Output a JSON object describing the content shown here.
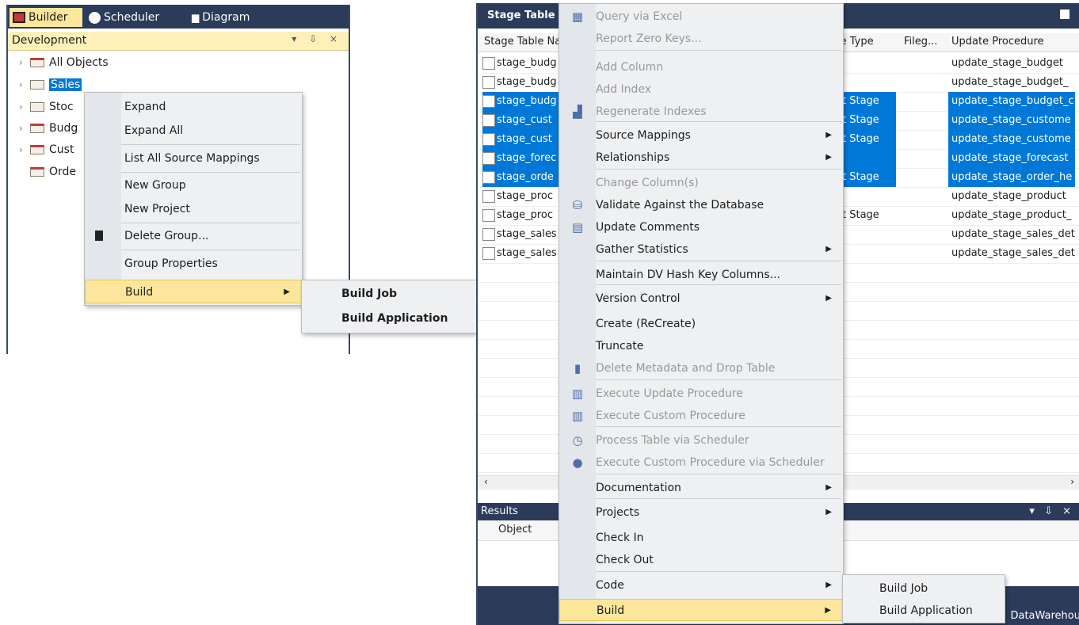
{
  "left_panel": {
    "tabs": [
      {
        "label": "Builder"
      },
      {
        "label": "Scheduler"
      },
      {
        "label": "Diagram"
      }
    ],
    "pane_title": "Development",
    "pane_buttons": "▾ ⇩ ×",
    "tree": [
      {
        "label": "All Objects"
      },
      {
        "label": "Sales"
      },
      {
        "label": "Stoc"
      },
      {
        "label": "Budg"
      },
      {
        "label": "Cust"
      },
      {
        "label": "Orde"
      }
    ],
    "context_menu": [
      {
        "label": "Expand"
      },
      {
        "label": "Expand All"
      },
      {
        "label": "List All Source Mappings"
      },
      {
        "label": "New Group"
      },
      {
        "label": "New Project"
      },
      {
        "label": "Delete Group..."
      },
      {
        "label": "Group Properties"
      },
      {
        "label": "Build"
      }
    ],
    "build_submenu": [
      {
        "label": "Build Job"
      },
      {
        "label": "Build Application"
      }
    ]
  },
  "right_panel": {
    "title": "Stage Table",
    "columns": {
      "name": "Stage Table Na",
      "type": "le Type",
      "file": "Fileg...",
      "proc": "Update Procedure"
    },
    "rows": [
      {
        "name": "stage_budg",
        "type": "",
        "proc": "update_stage_budget",
        "selected": false
      },
      {
        "name": "stage_budg",
        "type": "",
        "proc": "update_stage_budget_",
        "selected": false
      },
      {
        "name": "stage_budg",
        "type": "t Stage",
        "proc": "update_stage_budget_c",
        "selected": true
      },
      {
        "name": "stage_cust",
        "type": "t Stage",
        "proc": "update_stage_custome",
        "selected": true
      },
      {
        "name": "stage_cust",
        "type": "t Stage",
        "proc": "update_stage_custome",
        "selected": true
      },
      {
        "name": "stage_forec",
        "type": "",
        "proc": "update_stage_forecast",
        "selected": true
      },
      {
        "name": "stage_orde",
        "type": "t Stage",
        "proc": "update_stage_order_he",
        "selected": true
      },
      {
        "name": "stage_proc",
        "type": "",
        "proc": "update_stage_product",
        "selected": false
      },
      {
        "name": "stage_proc",
        "type": "t Stage",
        "proc": "update_stage_product_",
        "selected": false
      },
      {
        "name": "stage_sales",
        "type": "",
        "proc": "update_stage_sales_det",
        "selected": false
      },
      {
        "name": "stage_sales",
        "type": "",
        "proc": "update_stage_sales_det",
        "selected": false
      }
    ],
    "results_title": "Results",
    "results_buttons": "▾ ⇩ ×",
    "results_column": "Object",
    "footer_text": "DataWarehou",
    "context_menu": [
      {
        "label": "Query via Excel",
        "disabled": true
      },
      {
        "label": "Report Zero Keys...",
        "disabled": true
      },
      {
        "label": "Add Column",
        "disabled": true
      },
      {
        "label": "Add Index",
        "disabled": true
      },
      {
        "label": "Regenerate Indexes",
        "disabled": true
      },
      {
        "label": "Source Mappings",
        "disabled": false
      },
      {
        "label": "Relationships",
        "disabled": false
      },
      {
        "label": "Change Column(s)",
        "disabled": true
      },
      {
        "label": "Validate Against the Database",
        "disabled": false
      },
      {
        "label": "Update Comments",
        "disabled": false
      },
      {
        "label": "Gather Statistics",
        "disabled": false
      },
      {
        "label": "Maintain DV Hash Key Columns...",
        "disabled": false
      },
      {
        "label": "Version Control",
        "disabled": false
      },
      {
        "label": "Create (ReCreate)",
        "disabled": false
      },
      {
        "label": "Truncate",
        "disabled": false
      },
      {
        "label": "Delete Metadata and Drop Table",
        "disabled": true
      },
      {
        "label": "Execute Update Procedure",
        "disabled": true
      },
      {
        "label": "Execute Custom Procedure",
        "disabled": true
      },
      {
        "label": "Process Table via Scheduler",
        "disabled": true
      },
      {
        "label": "Execute Custom Procedure via Scheduler",
        "disabled": true
      },
      {
        "label": "Documentation",
        "disabled": false
      },
      {
        "label": "Projects",
        "disabled": false
      },
      {
        "label": "Check In",
        "disabled": false
      },
      {
        "label": "Check Out",
        "disabled": false
      },
      {
        "label": "Code",
        "disabled": false
      },
      {
        "label": "Build",
        "disabled": false
      }
    ],
    "build_submenu": [
      {
        "label": "Build Job"
      },
      {
        "label": "Build Application"
      }
    ]
  },
  "colors": {
    "titlebar": "#2b3b5a",
    "selection": "#0078d7",
    "hover": "#fbe69c"
  }
}
